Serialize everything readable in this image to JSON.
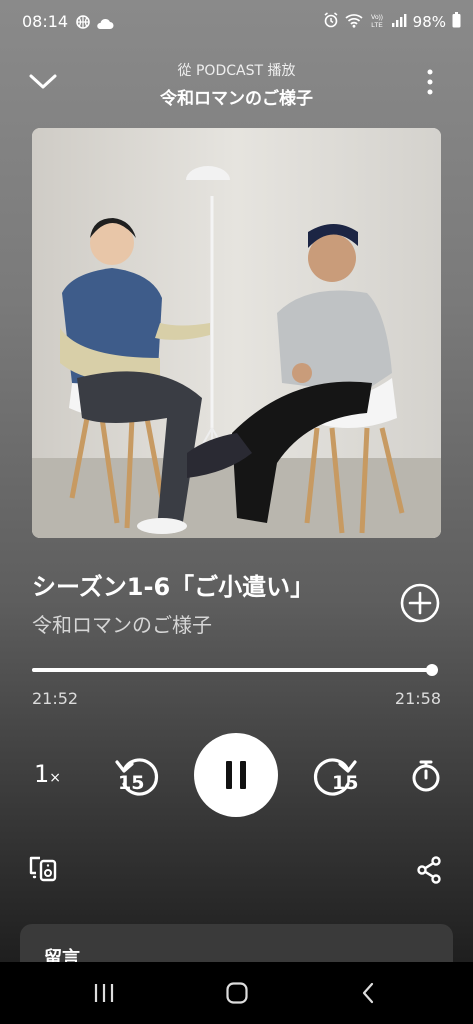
{
  "status_bar": {
    "time": "08:14",
    "battery": "98%",
    "icons": [
      "basketball-icon",
      "cloud-icon",
      "alarm-icon",
      "wifi-icon",
      "volte-icon",
      "signal-icon",
      "battery-icon"
    ],
    "volte_label": "VoLTE"
  },
  "header": {
    "subtitle": "從 PODCAST 播放",
    "title": "令和ロマンのご様子"
  },
  "track": {
    "title": "シーズン1-6「ご小遣い」",
    "show": "令和ロマンのご様子"
  },
  "progress": {
    "elapsed": "21:52",
    "total": "21:58",
    "fraction": 0.995
  },
  "controls": {
    "speed": "1",
    "speed_suffix": "×",
    "rewind_seconds": "15",
    "forward_seconds": "15",
    "state": "playing"
  },
  "card": {
    "label": "留言"
  },
  "colors": {
    "accent": "#ffffff",
    "background_top": "#8a8a8a",
    "background_bottom": "#1f1f1f"
  }
}
